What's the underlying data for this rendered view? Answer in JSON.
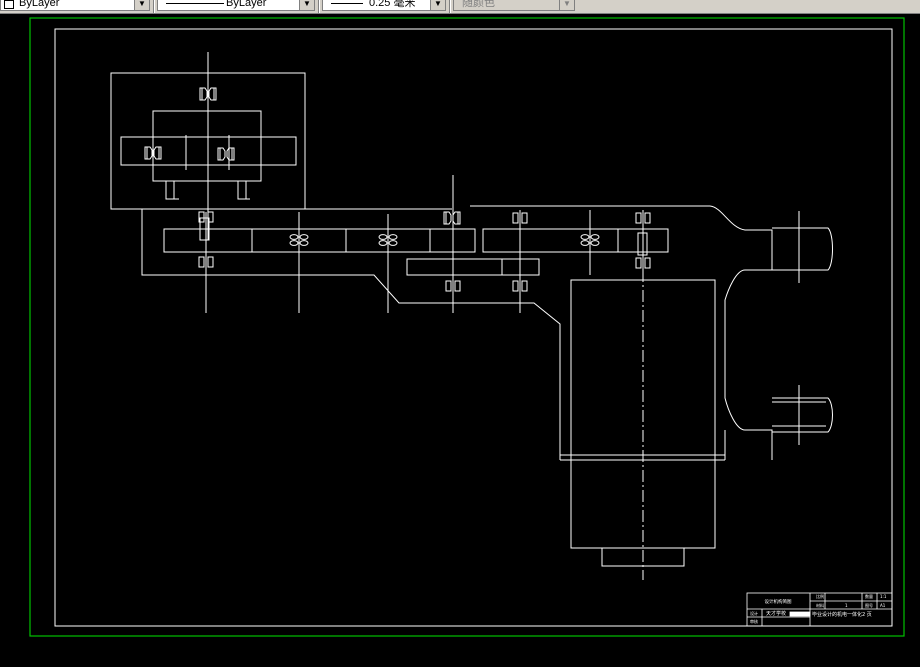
{
  "toolbar": {
    "color_value": "ByLayer",
    "linetype_value": "ByLayer",
    "lineweight_value": "0.25 毫米",
    "plotstyle_value": "随颜色"
  },
  "title_block": {
    "drawing_name": "设计机构简图",
    "school": "天才学校",
    "project": "毕业设计的机电一体化2 页",
    "scale_label": "比例",
    "scale_value": "1:1",
    "material_label": "材料",
    "sheet_label": "图号",
    "sheet_value": "A1",
    "qty_label": "数量",
    "qty_value": "1",
    "designer_label": "设计",
    "reviewer_label": "审核"
  },
  "colors": {
    "background": "#000000",
    "drawing_lines": "#ffffff",
    "outer_frame": "#00c000",
    "toolbar": "#d4d0c8"
  }
}
